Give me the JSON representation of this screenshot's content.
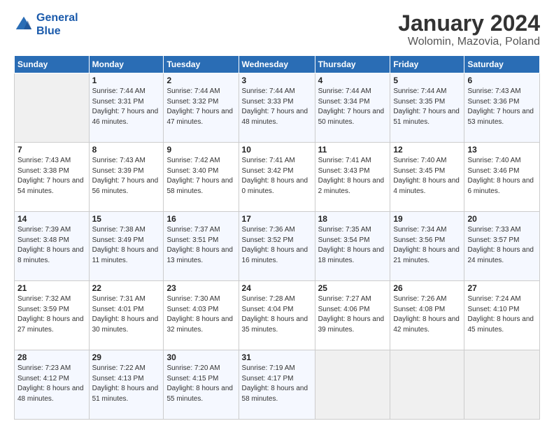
{
  "header": {
    "logo_line1": "General",
    "logo_line2": "Blue",
    "title": "January 2024",
    "subtitle": "Wolomin, Mazovia, Poland"
  },
  "weekdays": [
    "Sunday",
    "Monday",
    "Tuesday",
    "Wednesday",
    "Thursday",
    "Friday",
    "Saturday"
  ],
  "weeks": [
    [
      {
        "day": "",
        "sunrise": "",
        "sunset": "",
        "daylight": ""
      },
      {
        "day": "1",
        "sunrise": "Sunrise: 7:44 AM",
        "sunset": "Sunset: 3:31 PM",
        "daylight": "Daylight: 7 hours and 46 minutes."
      },
      {
        "day": "2",
        "sunrise": "Sunrise: 7:44 AM",
        "sunset": "Sunset: 3:32 PM",
        "daylight": "Daylight: 7 hours and 47 minutes."
      },
      {
        "day": "3",
        "sunrise": "Sunrise: 7:44 AM",
        "sunset": "Sunset: 3:33 PM",
        "daylight": "Daylight: 7 hours and 48 minutes."
      },
      {
        "day": "4",
        "sunrise": "Sunrise: 7:44 AM",
        "sunset": "Sunset: 3:34 PM",
        "daylight": "Daylight: 7 hours and 50 minutes."
      },
      {
        "day": "5",
        "sunrise": "Sunrise: 7:44 AM",
        "sunset": "Sunset: 3:35 PM",
        "daylight": "Daylight: 7 hours and 51 minutes."
      },
      {
        "day": "6",
        "sunrise": "Sunrise: 7:43 AM",
        "sunset": "Sunset: 3:36 PM",
        "daylight": "Daylight: 7 hours and 53 minutes."
      }
    ],
    [
      {
        "day": "7",
        "sunrise": "Sunrise: 7:43 AM",
        "sunset": "Sunset: 3:38 PM",
        "daylight": "Daylight: 7 hours and 54 minutes."
      },
      {
        "day": "8",
        "sunrise": "Sunrise: 7:43 AM",
        "sunset": "Sunset: 3:39 PM",
        "daylight": "Daylight: 7 hours and 56 minutes."
      },
      {
        "day": "9",
        "sunrise": "Sunrise: 7:42 AM",
        "sunset": "Sunset: 3:40 PM",
        "daylight": "Daylight: 7 hours and 58 minutes."
      },
      {
        "day": "10",
        "sunrise": "Sunrise: 7:41 AM",
        "sunset": "Sunset: 3:42 PM",
        "daylight": "Daylight: 8 hours and 0 minutes."
      },
      {
        "day": "11",
        "sunrise": "Sunrise: 7:41 AM",
        "sunset": "Sunset: 3:43 PM",
        "daylight": "Daylight: 8 hours and 2 minutes."
      },
      {
        "day": "12",
        "sunrise": "Sunrise: 7:40 AM",
        "sunset": "Sunset: 3:45 PM",
        "daylight": "Daylight: 8 hours and 4 minutes."
      },
      {
        "day": "13",
        "sunrise": "Sunrise: 7:40 AM",
        "sunset": "Sunset: 3:46 PM",
        "daylight": "Daylight: 8 hours and 6 minutes."
      }
    ],
    [
      {
        "day": "14",
        "sunrise": "Sunrise: 7:39 AM",
        "sunset": "Sunset: 3:48 PM",
        "daylight": "Daylight: 8 hours and 8 minutes."
      },
      {
        "day": "15",
        "sunrise": "Sunrise: 7:38 AM",
        "sunset": "Sunset: 3:49 PM",
        "daylight": "Daylight: 8 hours and 11 minutes."
      },
      {
        "day": "16",
        "sunrise": "Sunrise: 7:37 AM",
        "sunset": "Sunset: 3:51 PM",
        "daylight": "Daylight: 8 hours and 13 minutes."
      },
      {
        "day": "17",
        "sunrise": "Sunrise: 7:36 AM",
        "sunset": "Sunset: 3:52 PM",
        "daylight": "Daylight: 8 hours and 16 minutes."
      },
      {
        "day": "18",
        "sunrise": "Sunrise: 7:35 AM",
        "sunset": "Sunset: 3:54 PM",
        "daylight": "Daylight: 8 hours and 18 minutes."
      },
      {
        "day": "19",
        "sunrise": "Sunrise: 7:34 AM",
        "sunset": "Sunset: 3:56 PM",
        "daylight": "Daylight: 8 hours and 21 minutes."
      },
      {
        "day": "20",
        "sunrise": "Sunrise: 7:33 AM",
        "sunset": "Sunset: 3:57 PM",
        "daylight": "Daylight: 8 hours and 24 minutes."
      }
    ],
    [
      {
        "day": "21",
        "sunrise": "Sunrise: 7:32 AM",
        "sunset": "Sunset: 3:59 PM",
        "daylight": "Daylight: 8 hours and 27 minutes."
      },
      {
        "day": "22",
        "sunrise": "Sunrise: 7:31 AM",
        "sunset": "Sunset: 4:01 PM",
        "daylight": "Daylight: 8 hours and 30 minutes."
      },
      {
        "day": "23",
        "sunrise": "Sunrise: 7:30 AM",
        "sunset": "Sunset: 4:03 PM",
        "daylight": "Daylight: 8 hours and 32 minutes."
      },
      {
        "day": "24",
        "sunrise": "Sunrise: 7:28 AM",
        "sunset": "Sunset: 4:04 PM",
        "daylight": "Daylight: 8 hours and 35 minutes."
      },
      {
        "day": "25",
        "sunrise": "Sunrise: 7:27 AM",
        "sunset": "Sunset: 4:06 PM",
        "daylight": "Daylight: 8 hours and 39 minutes."
      },
      {
        "day": "26",
        "sunrise": "Sunrise: 7:26 AM",
        "sunset": "Sunset: 4:08 PM",
        "daylight": "Daylight: 8 hours and 42 minutes."
      },
      {
        "day": "27",
        "sunrise": "Sunrise: 7:24 AM",
        "sunset": "Sunset: 4:10 PM",
        "daylight": "Daylight: 8 hours and 45 minutes."
      }
    ],
    [
      {
        "day": "28",
        "sunrise": "Sunrise: 7:23 AM",
        "sunset": "Sunset: 4:12 PM",
        "daylight": "Daylight: 8 hours and 48 minutes."
      },
      {
        "day": "29",
        "sunrise": "Sunrise: 7:22 AM",
        "sunset": "Sunset: 4:13 PM",
        "daylight": "Daylight: 8 hours and 51 minutes."
      },
      {
        "day": "30",
        "sunrise": "Sunrise: 7:20 AM",
        "sunset": "Sunset: 4:15 PM",
        "daylight": "Daylight: 8 hours and 55 minutes."
      },
      {
        "day": "31",
        "sunrise": "Sunrise: 7:19 AM",
        "sunset": "Sunset: 4:17 PM",
        "daylight": "Daylight: 8 hours and 58 minutes."
      },
      {
        "day": "",
        "sunrise": "",
        "sunset": "",
        "daylight": ""
      },
      {
        "day": "",
        "sunrise": "",
        "sunset": "",
        "daylight": ""
      },
      {
        "day": "",
        "sunrise": "",
        "sunset": "",
        "daylight": ""
      }
    ]
  ]
}
